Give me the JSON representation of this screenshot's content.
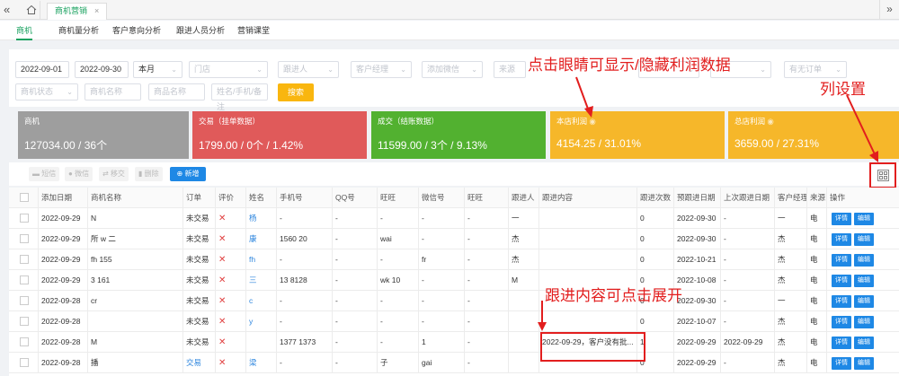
{
  "topbar": {
    "tab_label": "商机营销",
    "tab_close": "×",
    "nav_left": "«",
    "nav_right": "»"
  },
  "subnav": {
    "items": [
      "商机",
      "商机量分析",
      "客户意向分析",
      "跟进人员分析",
      "营销课堂"
    ],
    "active_index": 0
  },
  "filters": {
    "date_start": "2022-09-01",
    "date_end": "2022-09-30",
    "period": "本月",
    "store_ph": "门店",
    "follower_ph": "跟进人",
    "manager_ph": "客户经理",
    "wechat_ph": "添加微信",
    "source_ph": "来源",
    "order_ph": "有无订单",
    "status_ph": "商机状态",
    "name_ph": "商机名称",
    "product_ph": "商品名称",
    "contact_ph": "姓名/手机/备注",
    "search_label": "搜索"
  },
  "cards": [
    {
      "title": "商机",
      "value": "127034.00 / 36个",
      "color": "#9e9e9e"
    },
    {
      "title": "交易（挂单数据）",
      "value": "1799.00 / 0个 / 1.42%",
      "color": "#e05a5a"
    },
    {
      "title": "成交（结账数据）",
      "value": "11599.00 / 3个 / 9.13%",
      "color": "#52b130"
    },
    {
      "title": "本店利润",
      "value": "4154.25 / 31.01%",
      "color": "#f6b72a"
    },
    {
      "title": "总店利润",
      "value": "3659.00 / 27.31%",
      "color": "#f6b72a"
    }
  ],
  "toolbar": {
    "sms": "短信",
    "wechat": "微信",
    "transfer": "移交",
    "delete": "删除",
    "add": "新增"
  },
  "table": {
    "headers": [
      "添加日期",
      "商机名称",
      "订单",
      "评价",
      "姓名",
      "手机号",
      "QQ号",
      "旺旺",
      "微信号",
      "旺旺",
      "跟进人",
      "跟进内容",
      "跟进次数",
      "预跟进日期",
      "上次跟进日期",
      "客户经理",
      "来源",
      "操作"
    ],
    "rows": [
      {
        "date": "2022-09-29",
        "name": "N",
        "order": "未交易",
        "rating": "✕",
        "person": "杨",
        "phone": "-",
        "qq": "-",
        "ww": "-",
        "wx": "-",
        "ww2": "-",
        "follower": "一",
        "content": "",
        "count": "0",
        "next": "2022-09-30",
        "last": "-",
        "manager": "一",
        "source": "电"
      },
      {
        "date": "2022-09-29",
        "name": "所 w 二",
        "order": "未交易",
        "rating": "✕",
        "person": "康",
        "phone": "1560 20",
        "qq": "-",
        "ww": "wai",
        "wx": "-",
        "ww2": "-",
        "follower": "杰",
        "content": "",
        "count": "0",
        "next": "2022-09-30",
        "last": "-",
        "manager": "杰",
        "source": "电"
      },
      {
        "date": "2022-09-29",
        "name": "fh 155",
        "order": "未交易",
        "rating": "✕",
        "person": "fh",
        "phone": "-",
        "qq": "-",
        "ww": "-",
        "wx": "fr",
        "ww2": "-",
        "follower": "杰",
        "content": "",
        "count": "0",
        "next": "2022-10-21",
        "last": "-",
        "manager": "杰",
        "source": "电"
      },
      {
        "date": "2022-09-29",
        "name": "3 161",
        "order": "未交易",
        "rating": "✕",
        "person": "三",
        "phone": "13 8128",
        "qq": "-",
        "ww": "wk 10",
        "wx": "-",
        "ww2": "-",
        "follower": "M",
        "content": "",
        "count": "0",
        "next": "2022-10-08",
        "last": "-",
        "manager": "杰",
        "source": "电"
      },
      {
        "date": "2022-09-28",
        "name": "cr",
        "order": "未交易",
        "rating": "✕",
        "person": "c",
        "phone": "-",
        "qq": "-",
        "ww": "-",
        "wx": "-",
        "ww2": "-",
        "follower": "",
        "content": "",
        "count": "0",
        "next": "2022-09-30",
        "last": "-",
        "manager": "一",
        "source": "电"
      },
      {
        "date": "2022-09-28",
        "name": "",
        "order": "未交易",
        "rating": "✕",
        "person": "y",
        "phone": "-",
        "qq": "-",
        "ww": "-",
        "wx": "-",
        "ww2": "-",
        "follower": "",
        "content": "",
        "count": "0",
        "next": "2022-10-07",
        "last": "-",
        "manager": "杰",
        "source": "电"
      },
      {
        "date": "2022-09-28",
        "name": "M",
        "order": "未交易",
        "rating": "✕",
        "person": "",
        "phone": "1377 1373",
        "qq": "-",
        "ww": "-",
        "wx": "1",
        "ww2": "-",
        "follower": "",
        "content": "2022-09-29，客户没有批...",
        "count": "1",
        "next": "2022-09-29",
        "last": "2022-09-29",
        "manager": "杰",
        "source": "电"
      },
      {
        "date": "2022-09-28",
        "name": "播",
        "order": "交易",
        "rating": "✕",
        "person": "梁",
        "phone": "-",
        "qq": "-",
        "ww": "子",
        "wx": "gai",
        "ww2": "-",
        "follower": "",
        "content": "",
        "count": "0",
        "next": "2022-09-29",
        "last": "-",
        "manager": "杰",
        "source": "电"
      }
    ],
    "detail_label": "详情",
    "edit_label": "编辑"
  },
  "annotations": {
    "eye_note": "点击眼睛可显示/隐藏利润数据",
    "column_note": "列设置",
    "follow_note": "跟进内容可点击展开"
  }
}
